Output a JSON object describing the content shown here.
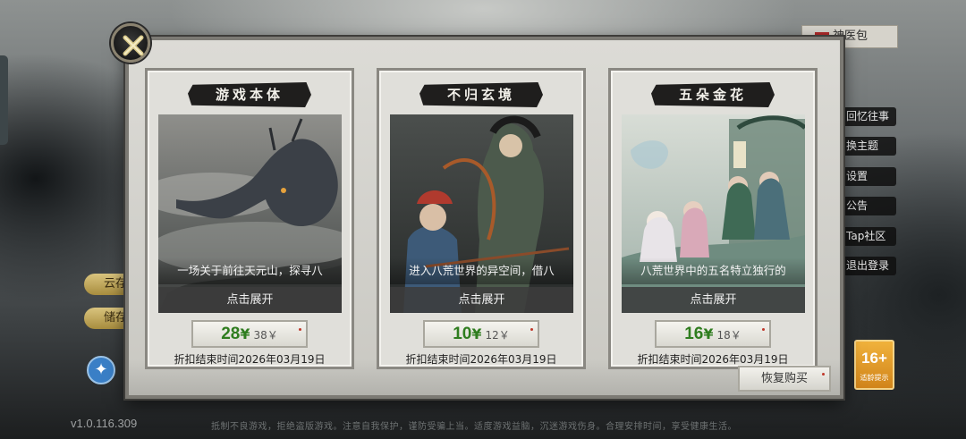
{
  "background": {
    "top_right_button": "神医包",
    "left_pills": [
      "云存",
      "储存"
    ],
    "side_menu": [
      "回忆往事",
      "换主题",
      "设置",
      "公告",
      "Tap社区",
      "退出登录"
    ],
    "age_rating": {
      "number": "16+",
      "caption": "适龄提示"
    },
    "version": "v1.0.116.309",
    "footer_note": "抵制不良游戏，拒绝盗版游戏。注意自我保护，谨防受骗上当。适度游戏益脑，沉迷游戏伤身。合理安排时间，享受健康生活。"
  },
  "modal": {
    "close_icon": "close-x-icon",
    "restore_label": "恢复购买",
    "products": [
      {
        "title": "游戏本体",
        "description": "一场关于前往天元山，探寻八",
        "expand_label": "点击展开",
        "price": "28",
        "currency": "¥",
        "original_price": "38￥",
        "deadline": "折扣结束时间2026年03月19日"
      },
      {
        "title": "不归玄境",
        "description": "进入八荒世界的异空间，借八",
        "expand_label": "点击展开",
        "price": "10",
        "currency": "¥",
        "original_price": "12￥",
        "deadline": "折扣结束时间2026年03月19日"
      },
      {
        "title": "五朵金花",
        "description": "八荒世界中的五名特立独行的",
        "expand_label": "点击展开",
        "price": "16",
        "currency": "¥",
        "original_price": "18￥",
        "deadline": "折扣结束时间2026年03月19日"
      }
    ]
  }
}
